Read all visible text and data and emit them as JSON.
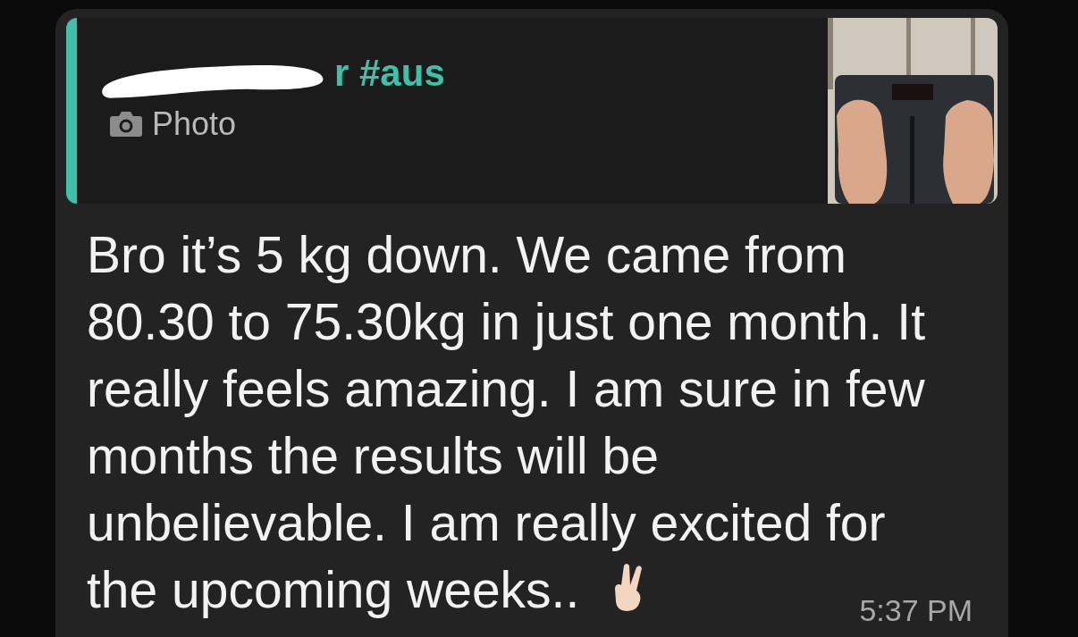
{
  "quote": {
    "author": "r #aus",
    "redacted": true,
    "label": "Photo"
  },
  "message": {
    "lines": [
      "Bro it’s 5 kg down. We came from",
      "80.30 to 75.30kg in just one month. It",
      "really feels amazing. I am sure in few",
      "months the results will be",
      "unbelievable. I am really excited for",
      "the upcoming weeks.."
    ],
    "time": "5:37 PM"
  }
}
